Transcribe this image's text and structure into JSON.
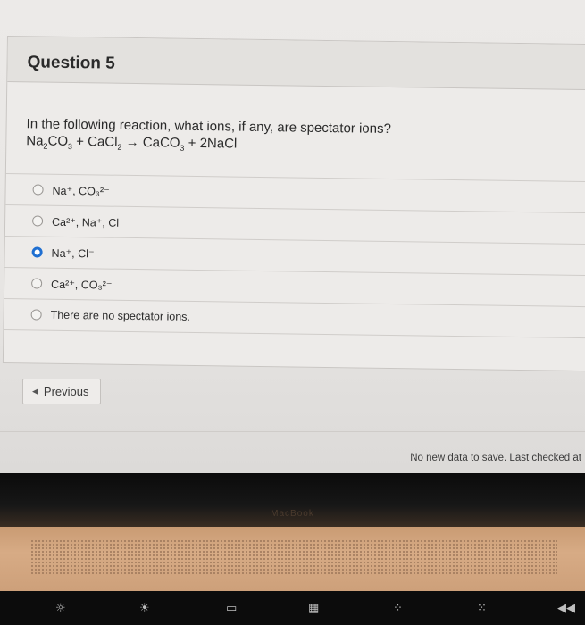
{
  "question": {
    "title": "Question 5",
    "prompt": "In the following reaction, what ions, if any, are spectator ions?"
  },
  "options": [
    {
      "label": "Na⁺, CO₃²⁻",
      "selected": false
    },
    {
      "label": "Ca²⁺, Na⁺, Cl⁻",
      "selected": false
    },
    {
      "label": "Na⁺, Cl⁻",
      "selected": true
    },
    {
      "label": "Ca²⁺, CO₃²⁻",
      "selected": false
    },
    {
      "label": "There are no spectator ions.",
      "selected": false
    }
  ],
  "navigation": {
    "previous_label": "Previous"
  },
  "status": {
    "save_message": "No new data to save. Last checked at"
  },
  "device": {
    "brand": "MacBook"
  },
  "colors": {
    "selected_radio": "#1f6fd1"
  }
}
